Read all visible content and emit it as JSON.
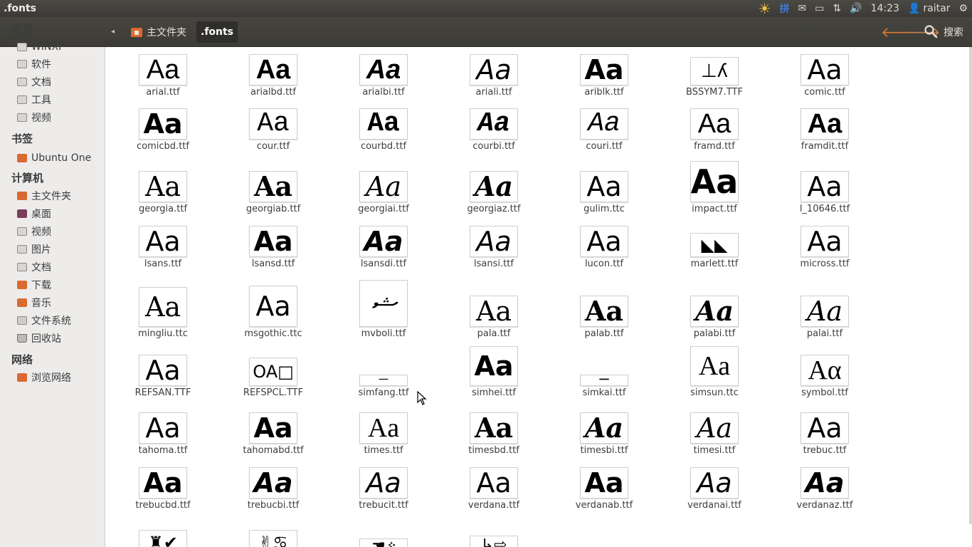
{
  "window": {
    "title": ".fonts"
  },
  "panel": {
    "clock": "14:23",
    "user": "raitar",
    "indicators": [
      "weather-icon",
      "input-method-icon",
      "mail-icon",
      "battery-icon",
      "network-icon",
      "volume-icon"
    ],
    "input_method": "拼"
  },
  "toolbar": {
    "crumbs": [
      {
        "label": "主文件夹"
      },
      {
        "label": ".fonts"
      }
    ],
    "search_label": "搜索"
  },
  "sidebar": {
    "sections": [
      {
        "title": "设备",
        "items": [
          "WINXP",
          "软件",
          "文档",
          "工具",
          "视频"
        ]
      },
      {
        "title": "书签",
        "items": [
          "Ubuntu One"
        ]
      },
      {
        "title": "计算机",
        "items": [
          "主文件夹",
          "桌面",
          "视频",
          "图片",
          "文档",
          "下载",
          "音乐",
          "文件系统",
          "回收站"
        ]
      },
      {
        "title": "网络",
        "items": [
          "浏览网络"
        ]
      }
    ]
  },
  "files": [
    {
      "name": "arial.ttf",
      "preview": "Aa"
    },
    {
      "name": "arialbd.ttf",
      "preview": "Aa"
    },
    {
      "name": "arialbi.ttf",
      "preview": "Aa"
    },
    {
      "name": "ariali.ttf",
      "preview": "Aa"
    },
    {
      "name": "ariblk.ttf",
      "preview": "Aa"
    },
    {
      "name": "BSSYM7.TTF",
      "preview": "⊥ʎ"
    },
    {
      "name": "comic.ttf",
      "preview": "Aa"
    },
    {
      "name": "comicbd.ttf",
      "preview": "Aa"
    },
    {
      "name": "cour.ttf",
      "preview": "Aa"
    },
    {
      "name": "courbd.ttf",
      "preview": "Aa"
    },
    {
      "name": "courbi.ttf",
      "preview": "Aa"
    },
    {
      "name": "couri.ttf",
      "preview": "Aa"
    },
    {
      "name": "framd.ttf",
      "preview": "Aa"
    },
    {
      "name": "framdit.ttf",
      "preview": "Aa"
    },
    {
      "name": "georgia.ttf",
      "preview": "Aa"
    },
    {
      "name": "georgiab.ttf",
      "preview": "Aa"
    },
    {
      "name": "georgiai.ttf",
      "preview": "Aa"
    },
    {
      "name": "georgiaz.ttf",
      "preview": "Aa"
    },
    {
      "name": "gulim.ttc",
      "preview": "Aa"
    },
    {
      "name": "impact.ttf",
      "preview": "Aa"
    },
    {
      "name": "l_10646.ttf",
      "preview": "Aa"
    },
    {
      "name": "lsans.ttf",
      "preview": "Aa"
    },
    {
      "name": "lsansd.ttf",
      "preview": "Aa"
    },
    {
      "name": "lsansdi.ttf",
      "preview": "Aa"
    },
    {
      "name": "lsansi.ttf",
      "preview": "Aa"
    },
    {
      "name": "lucon.ttf",
      "preview": "Aa"
    },
    {
      "name": "marlett.ttf",
      "preview": "◣◣"
    },
    {
      "name": "micross.ttf",
      "preview": "Aa"
    },
    {
      "name": "mingliu.ttc",
      "preview": "Aa"
    },
    {
      "name": "msgothic.ttc",
      "preview": "Aa"
    },
    {
      "name": "mvboli.ttf",
      "preview": "ޝ"
    },
    {
      "name": "pala.ttf",
      "preview": "Aa"
    },
    {
      "name": "palab.ttf",
      "preview": "Aa"
    },
    {
      "name": "palabi.ttf",
      "preview": "Aa"
    },
    {
      "name": "palai.ttf",
      "preview": "Aa"
    },
    {
      "name": "REFSAN.TTF",
      "preview": "Aa"
    },
    {
      "name": "REFSPCL.TTF",
      "preview": "OA□"
    },
    {
      "name": "simfang.ttf",
      "preview": "一"
    },
    {
      "name": "simhei.ttf",
      "preview": "Aa"
    },
    {
      "name": "simkai.ttf",
      "preview": "一"
    },
    {
      "name": "simsun.ttc",
      "preview": "Aa"
    },
    {
      "name": "symbol.ttf",
      "preview": "Αα"
    },
    {
      "name": "tahoma.ttf",
      "preview": "Aa"
    },
    {
      "name": "tahomabd.ttf",
      "preview": "Aa"
    },
    {
      "name": "times.ttf",
      "preview": "Aa"
    },
    {
      "name": "timesbd.ttf",
      "preview": "Aa"
    },
    {
      "name": "timesbi.ttf",
      "preview": "Aa"
    },
    {
      "name": "timesi.ttf",
      "preview": "Aa"
    },
    {
      "name": "trebuc.ttf",
      "preview": "Aa"
    },
    {
      "name": "trebucbd.ttf",
      "preview": "Aa"
    },
    {
      "name": "trebucbi.ttf",
      "preview": "Aa"
    },
    {
      "name": "trebucit.ttf",
      "preview": "Aa"
    },
    {
      "name": "verdana.ttf",
      "preview": "Aa"
    },
    {
      "name": "verdanab.ttf",
      "preview": "Aa"
    },
    {
      "name": "verdanai.ttf",
      "preview": "Aa"
    },
    {
      "name": "verdanaz.ttf",
      "preview": "Aa"
    },
    {
      "name": "",
      "preview": "♜✔"
    },
    {
      "name": "",
      "preview": "✌♋"
    },
    {
      "name": "",
      "preview": "☚ઙ"
    },
    {
      "name": "",
      "preview": "↳⇨"
    }
  ]
}
